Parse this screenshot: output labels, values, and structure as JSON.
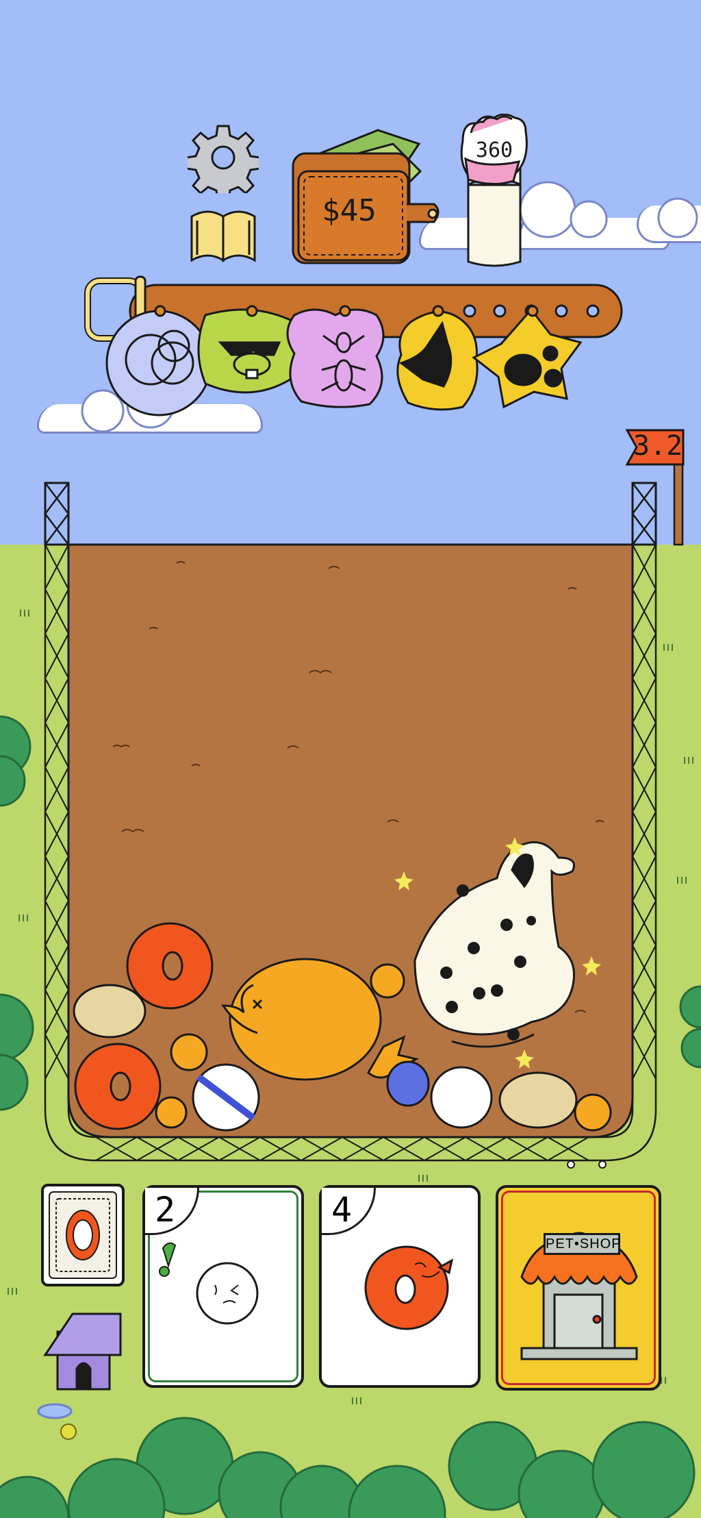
{
  "hud": {
    "money": "$45",
    "score": "360",
    "level": "3.2"
  },
  "hand": {
    "cards": [
      {
        "count": "2",
        "pet": "white-fluffy-pet"
      },
      {
        "count": "4",
        "pet": "orange-donut-dog"
      }
    ],
    "shop_sign": "PET•SHOP"
  },
  "collar_tags": [
    "bubbles-tag",
    "sunglasses-beaver-tag",
    "ant-tag",
    "dog-head-tag",
    "paw-spots-tag"
  ],
  "colors": {
    "sky": "#a2bdf8",
    "grass": "#bcd76a",
    "dirt": "#b57543",
    "wallet": "#d97a2a",
    "flag": "#ef5a2a",
    "shop_card": "#f5cc2e"
  }
}
